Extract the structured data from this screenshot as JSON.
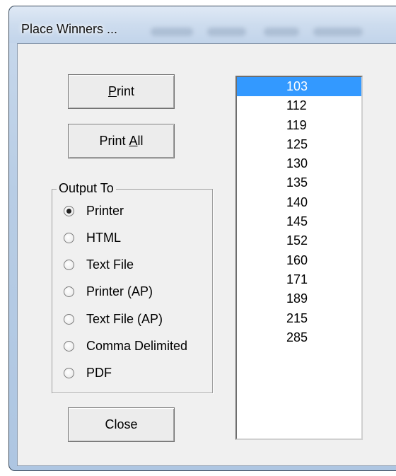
{
  "window": {
    "title": "Place Winners ..."
  },
  "buttons": {
    "print": {
      "label_mnemonic": "P",
      "label_rest": "rint"
    },
    "print_all": {
      "label_before": "Print ",
      "label_mnemonic": "A",
      "label_after": "ll"
    },
    "close": {
      "label": "Close"
    }
  },
  "output_to": {
    "legend": "Output To",
    "selected": "Printer",
    "options": [
      "Printer",
      "HTML",
      "Text File",
      "Printer (AP)",
      "Text File (AP)",
      "Comma Delimited",
      "PDF"
    ]
  },
  "list": {
    "selected": "103",
    "items": [
      "103",
      "112",
      "119",
      "125",
      "130",
      "135",
      "140",
      "145",
      "152",
      "160",
      "171",
      "189",
      "215",
      "285"
    ]
  },
  "colors": {
    "selection": "#3399ff",
    "dialog_bg": "#f0f0f0"
  }
}
